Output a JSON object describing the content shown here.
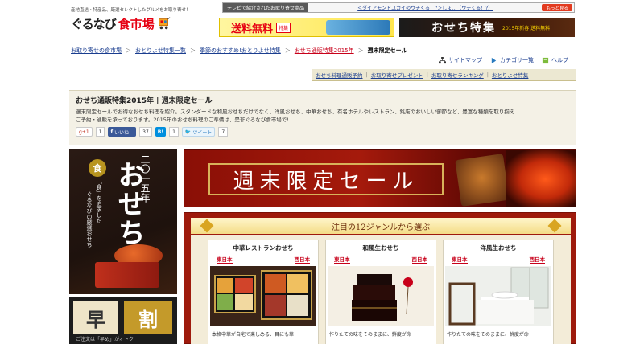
{
  "header": {
    "tagline": "産地直送・特産品、厳選セレクトしたグルメをお取り寄せ！",
    "logo_text": "ぐるなび",
    "logo_sub": "食市場"
  },
  "ticker": {
    "label": "テレビで紹介されたお取り寄せ商品",
    "text": "＜ダイアモンドユカイのウチくる！?＞しょ…（ウチくる！?）",
    "more": "もっと見る"
  },
  "banners": {
    "shipping_big": "送料無料",
    "shipping_small": "特集",
    "osechi_big": "おせち特集",
    "osechi_small": "2015年新春 送料無料"
  },
  "breadcrumbs": [
    "お取り寄せの食市場",
    "おとりよせ特集一覧",
    "季節のおすすめ!おとりよせ特集",
    "おせち通販特集2015年",
    "週末限定セール"
  ],
  "util": {
    "sitemap": "サイトマップ",
    "category": "カテゴリ一覧",
    "help": "ヘルプ"
  },
  "tabs": [
    "おせち料理通販予約",
    "お取り寄せプレゼント",
    "お取り寄せランキング",
    "おとりよせ特集"
  ],
  "intro": {
    "title": "おせち通販特集2015年 | 週末限定セール",
    "line1": "週末限定セールでお得なおせち料理を紹介。スタンダードな和風おせちだけでなく、洋風おせち、中華おせち、有名ホテルやレストラン、銘店のおいしい御節など、豊富な種類を取り揃え",
    "line2": "ご予約・通販を承っております。2015年のおせち料理のご準備は、是非ぐるなび食市場で!"
  },
  "social": {
    "gplus_label": "g+1",
    "gplus_count": "1",
    "fb_label": "いいね！",
    "fb_count": "37",
    "hatena_label": "B!",
    "hatena_count": "1",
    "tweet_label": "ツイート",
    "tweet_count": "7"
  },
  "left_banner": {
    "year": "二〇一五年",
    "title": "おせち",
    "copy1": "「食」を追求した",
    "copy2": "ぐるなびの厳選おせち"
  },
  "early_banner": {
    "w1": "早",
    "w2": "割",
    "caption": "ご注文は「早め」がオトク"
  },
  "hero": {
    "title": "週末限定セール"
  },
  "genre": {
    "heading": "注目の12ジャンルから選ぶ",
    "cards": [
      {
        "title": "中華レストランおせち",
        "east": "東日本",
        "west": "西日本",
        "desc": "本格中華が自宅で楽しめる、目にも華"
      },
      {
        "title": "和風生おせち",
        "east": "東日本",
        "west": "西日本",
        "desc": "作りたての味をそのままに、鮮度が命"
      },
      {
        "title": "洋風生おせち",
        "east": "東日本",
        "west": "西日本",
        "desc": "作りたての味をそのままに、鮮度が命"
      }
    ]
  }
}
